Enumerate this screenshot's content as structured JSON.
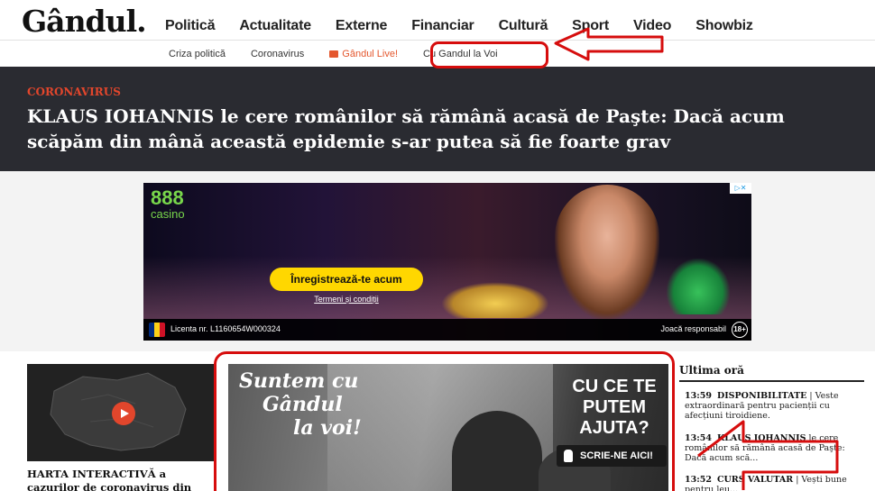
{
  "header": {
    "logo_text": "Gândul",
    "nav": [
      "Politică",
      "Actualitate",
      "Externe",
      "Financiar",
      "Cultură",
      "Sport",
      "Video",
      "Showbiz"
    ],
    "subnav": [
      "Criza politică",
      "Coronavirus",
      "Gândul Live!",
      "Cu Gandul la Voi"
    ]
  },
  "breaking": {
    "kicker": "CORONAVIRUS",
    "headline": "KLAUS IOHANNIS le cere românilor să rămână acasă de Paşte: Dacă acum scăpăm din mână această epidemie s-ar putea să fie foarte grav"
  },
  "ad": {
    "brand_number": "888",
    "brand_word": "casino",
    "cta": "Înregistrează-te acum",
    "terms": "Termeni și condiții",
    "license": "Licenta nr. L1160654W000324",
    "responsible": "Joacă responsabil",
    "age": "18+",
    "adchoices": "▷✕"
  },
  "content": {
    "map_caption": "HARTA INTERACTIVĂ a cazurilor de coronavirus din România, dar și",
    "feature": {
      "slogan_line1": "Suntem cu",
      "slogan_line2": "Gândul",
      "slogan_line3": "la voi!",
      "help_text": "CU CE TE PUTEM AJUTA?",
      "write_button": "SCRIE-NE AICI!"
    },
    "sidebar": {
      "title": "Ultima oră",
      "items": [
        {
          "time": "13:59",
          "tag": "DISPONIBILITATE",
          "text": "| Veste extraordinară pentru pacienții cu afecțiuni tiroidiene."
        },
        {
          "time": "13:54",
          "tag": "KLAUS IOHANNIS",
          "text": "le cere românilor să rămână acasă de Paşte: Dacă acum scă..."
        },
        {
          "time": "13:52",
          "tag": "CURS VALUTAR",
          "text": "| Vești bune pentru leu..."
        }
      ]
    }
  },
  "colors": {
    "accent_red": "#e2462c",
    "annotation_red": "#d60d0d",
    "band_dark": "#2a2b31"
  }
}
